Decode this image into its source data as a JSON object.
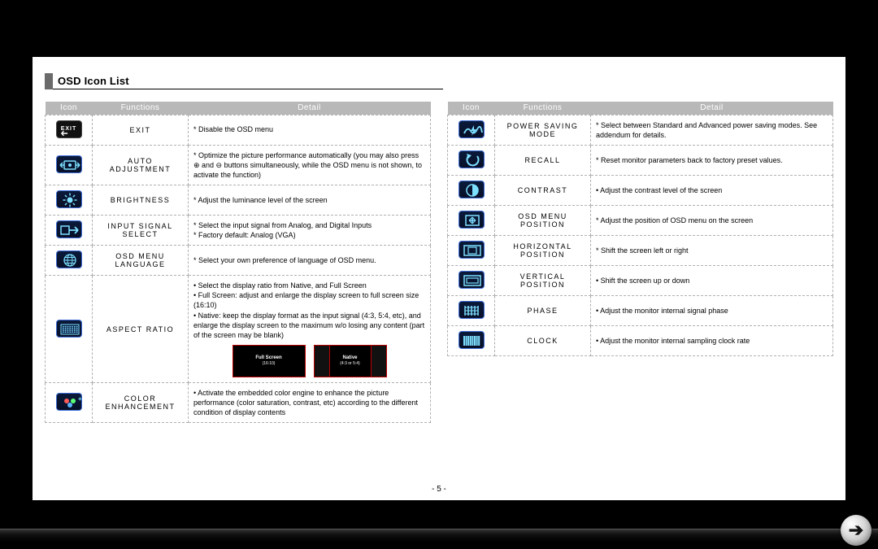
{
  "section_title": "OSD Icon List",
  "page_number": "- 5 -",
  "headers": {
    "icon": "Icon",
    "functions": "Functions",
    "detail": "Detail"
  },
  "aspect_thumbs": {
    "full": {
      "label": "Full Screen",
      "sub": "(16:10)"
    },
    "native": {
      "label": "Native",
      "sub": "(4:3 or 5:4)"
    }
  },
  "left": [
    {
      "icon": "exit",
      "func": "Exit",
      "detail": [
        "* Disable the OSD menu"
      ]
    },
    {
      "icon": "auto",
      "func": "Auto Adjustment",
      "detail": [
        "* Optimize the picture performance automatically (you may also press ⊕ and ⊖ buttons simultaneously, while the OSD menu is not shown, to activate the function)"
      ]
    },
    {
      "icon": "brightness",
      "func": "Brightness",
      "detail": [
        "* Adjust the luminance level of the screen"
      ]
    },
    {
      "icon": "input",
      "func": "Input Signal Select",
      "detail": [
        "* Select the input signal from Analog, and Digital Inputs",
        "* Factory default: Analog (VGA)"
      ]
    },
    {
      "icon": "language",
      "func": "OSD Menu Language",
      "detail": [
        "* Select your own preference of language of OSD menu."
      ]
    },
    {
      "icon": "aspect",
      "func": "Aspect Ratio",
      "aspect_preview": true,
      "detail": [
        "• Select the display ratio from Native, and Full Screen",
        "• Full Screen: adjust and enlarge the display screen to full screen size (16:10)",
        "• Native: keep the display format as the input signal (4:3, 5:4, etc), and enlarge the display screen to the maximum w/o losing any content (part of the screen may be blank)"
      ]
    },
    {
      "icon": "color",
      "func": "Color Enhancement",
      "detail": [
        "• Activate the embedded color engine to enhance the picture performance (color saturation, contrast, etc) according to the different condition of display contents"
      ]
    }
  ],
  "right": [
    {
      "icon": "power",
      "func": "Power Saving Mode",
      "detail": [
        "* Select between Standard and Advanced power saving modes. See addendum for details."
      ]
    },
    {
      "icon": "recall",
      "func": "Recall",
      "detail": [
        "* Reset monitor parameters back to factory preset values."
      ]
    },
    {
      "icon": "contrast",
      "func": "Contrast",
      "detail": [
        "• Adjust the contrast level of the screen"
      ]
    },
    {
      "icon": "osdpos",
      "func": "OSD Menu Position",
      "detail": [
        "* Adjust the position of OSD menu on the screen"
      ]
    },
    {
      "icon": "hpos",
      "func": "Horizontal Position",
      "detail": [
        "* Shift the screen left or right"
      ]
    },
    {
      "icon": "vpos",
      "func": "Vertical Position",
      "detail": [
        "• Shift the screen up or down"
      ]
    },
    {
      "icon": "phase",
      "func": "Phase",
      "detail": [
        "• Adjust the monitor internal signal phase"
      ]
    },
    {
      "icon": "clock",
      "func": "Clock",
      "detail": [
        "• Adjust the monitor internal sampling clock rate"
      ]
    }
  ]
}
